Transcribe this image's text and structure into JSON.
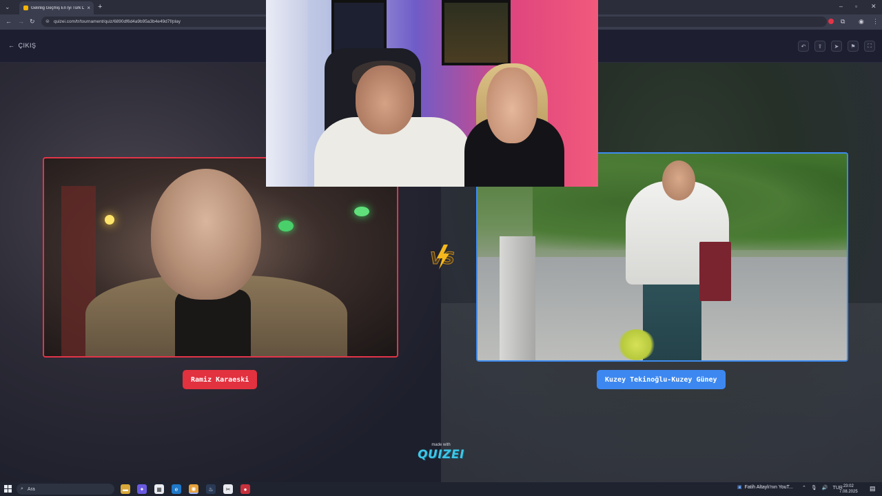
{
  "browser": {
    "tab_title": "Gelinlig Geçmiş En İyi Türk Dizi",
    "url": "quizei.com/tr/tournament/quiz/6890df6d4a9b95a3b4e49d7f/play"
  },
  "page": {
    "exit_label": "ÇIKIŞ",
    "header_buttons": [
      "undo-icon",
      "share-icon",
      "send-icon",
      "flag-icon",
      "fullscreen-icon"
    ]
  },
  "match": {
    "left_name": "Ramiz Karaeski",
    "right_name": "Kuzey Tekinoğlu-Kuzey Güney",
    "vs_label": "VS",
    "left_color": "#e2313f",
    "right_color": "#3d88f0"
  },
  "footer": {
    "made_with": "made with",
    "brand": "QUIZEI"
  },
  "taskbar": {
    "search_label": "Ara",
    "notification": "Fatih Altaylı'nın YouT...",
    "language": "TUR",
    "time": "23:02",
    "date": "7.08.2025"
  }
}
